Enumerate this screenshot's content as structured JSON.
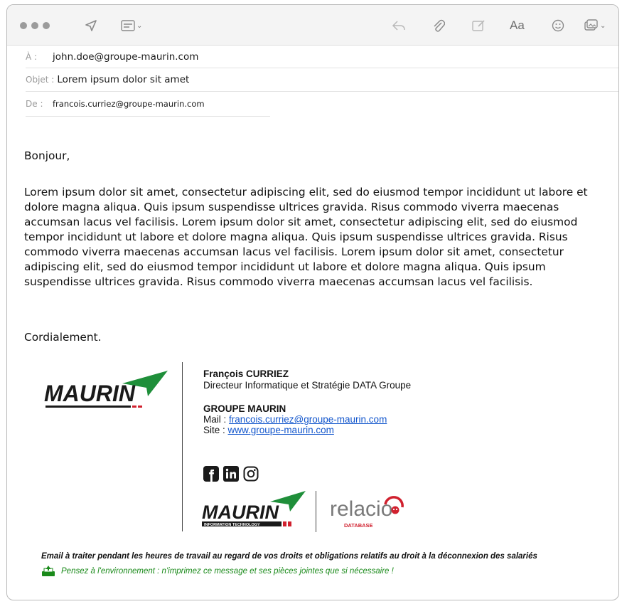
{
  "toolbar": {
    "send_icon": "send-icon",
    "format_icon": "header-fields-icon",
    "reply_icon": "reply-icon",
    "attach_icon": "paperclip-icon",
    "markup_icon": "markup-icon",
    "font_label": "Aa",
    "emoji_icon": "emoji-icon",
    "photo_icon": "photo-browser-icon"
  },
  "headers": {
    "to_label": "À :",
    "to_value": "john.doe@groupe-maurin.com",
    "subject_label": "Objet :",
    "subject_value": "Lorem ipsum dolor sit amet",
    "from_label": "De :",
    "from_value": "francois.curriez@groupe-maurin.com"
  },
  "message": {
    "greeting": "Bonjour,",
    "paragraph": "Lorem ipsum dolor sit amet, consectetur adipiscing elit, sed do eiusmod tempor incididunt ut labore et dolore magna aliqua. Quis ipsum suspendisse ultrices gravida. Risus commodo viverra maecenas accumsan lacus vel facilisis. Lorem ipsum dolor sit amet, consectetur adipiscing elit, sed do eiusmod tempor incididunt ut labore et dolore magna aliqua. Quis ipsum suspendisse ultrices gravida. Risus commodo viverra maecenas accumsan lacus vel facilisis. Lorem ipsum dolor sit amet, consectetur adipiscing elit, sed do eiusmod tempor incididunt ut labore et dolore magna aliqua. Quis ipsum suspendisse ultrices gravida. Risus commodo viverra maecenas accumsan lacus vel facilisis.",
    "closing": "Cordialement."
  },
  "signature": {
    "logo_text": "MAURIN",
    "name": "François CURRIEZ",
    "title": "Directeur Informatique et Stratégie DATA Groupe",
    "company": "GROUPE MAURIN",
    "mail_label": "Mail :",
    "mail_value": "francois.curriez@groupe-maurin.com",
    "site_label": "Site :",
    "site_value": "www.groupe-maurin.com",
    "logo2_text": "MAURIN",
    "logo2_subtitle": "INFORMATION TECHNOLOGY",
    "relacio_text": "relacio",
    "relacio_subtitle": "DATABASE"
  },
  "footer": {
    "disclaimer": "Email à traiter pendant les heures de travail au regard de vos droits et obligations relatifs au droit à la déconnexion des salariés",
    "eco_note": "Pensez à l'environnement : n'imprimez ce message et ses pièces jointes que si nécessaire !"
  },
  "colors": {
    "brand_green": "#1f8f3a",
    "brand_red": "#d0202e",
    "link_blue": "#1155cc",
    "eco_green": "#1a8a1a"
  }
}
